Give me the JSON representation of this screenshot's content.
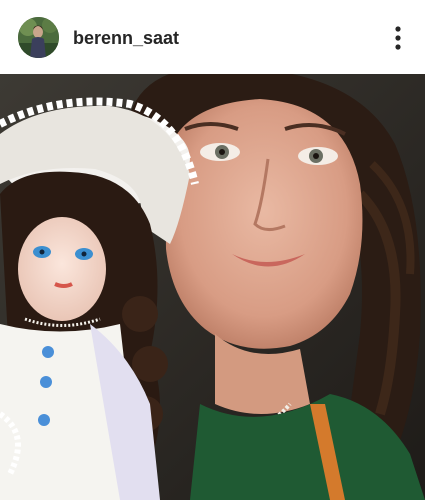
{
  "post": {
    "username": "berenn_saat",
    "more_icon": "more-vertical-icon",
    "avatar_icon": "profile-avatar"
  },
  "colors": {
    "background": "#ffffff",
    "username_text": "#262626",
    "icon": "#262626"
  }
}
